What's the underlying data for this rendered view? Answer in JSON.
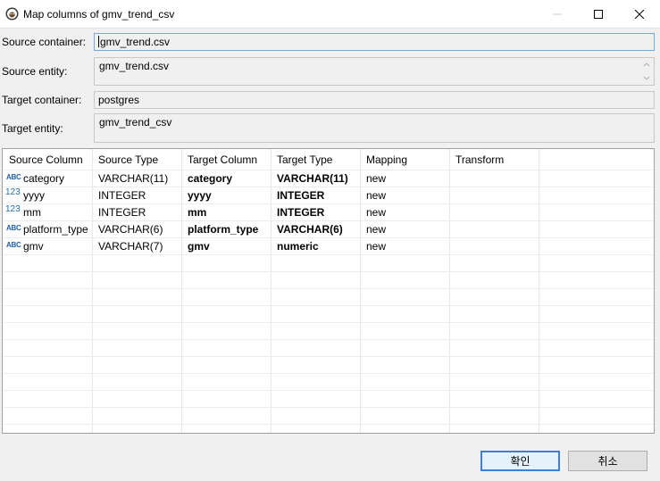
{
  "window": {
    "title": "Map columns of gmv_trend_csv",
    "minimize_icon": "minimize-icon",
    "maximize_icon": "maximize-icon",
    "close_icon": "close-icon"
  },
  "form": {
    "source_container_label": "Source container:",
    "source_container_value": "gmv_trend.csv",
    "source_entity_label": "Source entity:",
    "source_entity_value": "gmv_trend.csv",
    "target_container_label": "Target container:",
    "target_container_value": "postgres",
    "target_entity_label": "Target entity:",
    "target_entity_value": "gmv_trend_csv"
  },
  "table": {
    "headers": [
      "Source Column",
      "Source Type",
      "Target Column",
      "Target Type",
      "Mapping",
      "Transform"
    ],
    "rows": [
      {
        "icon": "ABC",
        "source_column": "category",
        "source_type": "VARCHAR(11)",
        "target_column": "category",
        "target_type": "VARCHAR(11)",
        "mapping": "new",
        "transform": ""
      },
      {
        "icon": "123",
        "source_column": "yyyy",
        "source_type": "INTEGER",
        "target_column": "yyyy",
        "target_type": "INTEGER",
        "mapping": "new",
        "transform": ""
      },
      {
        "icon": "123",
        "source_column": "mm",
        "source_type": "INTEGER",
        "target_column": "mm",
        "target_type": "INTEGER",
        "mapping": "new",
        "transform": ""
      },
      {
        "icon": "ABC",
        "source_column": "platform_type",
        "source_type": "VARCHAR(6)",
        "target_column": "platform_type",
        "target_type": "VARCHAR(6)",
        "mapping": "new",
        "transform": ""
      },
      {
        "icon": "ABC",
        "source_column": "gmv",
        "source_type": "VARCHAR(7)",
        "target_column": "gmv",
        "target_type": "numeric",
        "mapping": "new",
        "transform": ""
      }
    ]
  },
  "buttons": {
    "ok": "확인",
    "cancel": "취소"
  },
  "colors": {
    "accent": "#3c7fd8",
    "type_icon": "#1f5fa8"
  }
}
